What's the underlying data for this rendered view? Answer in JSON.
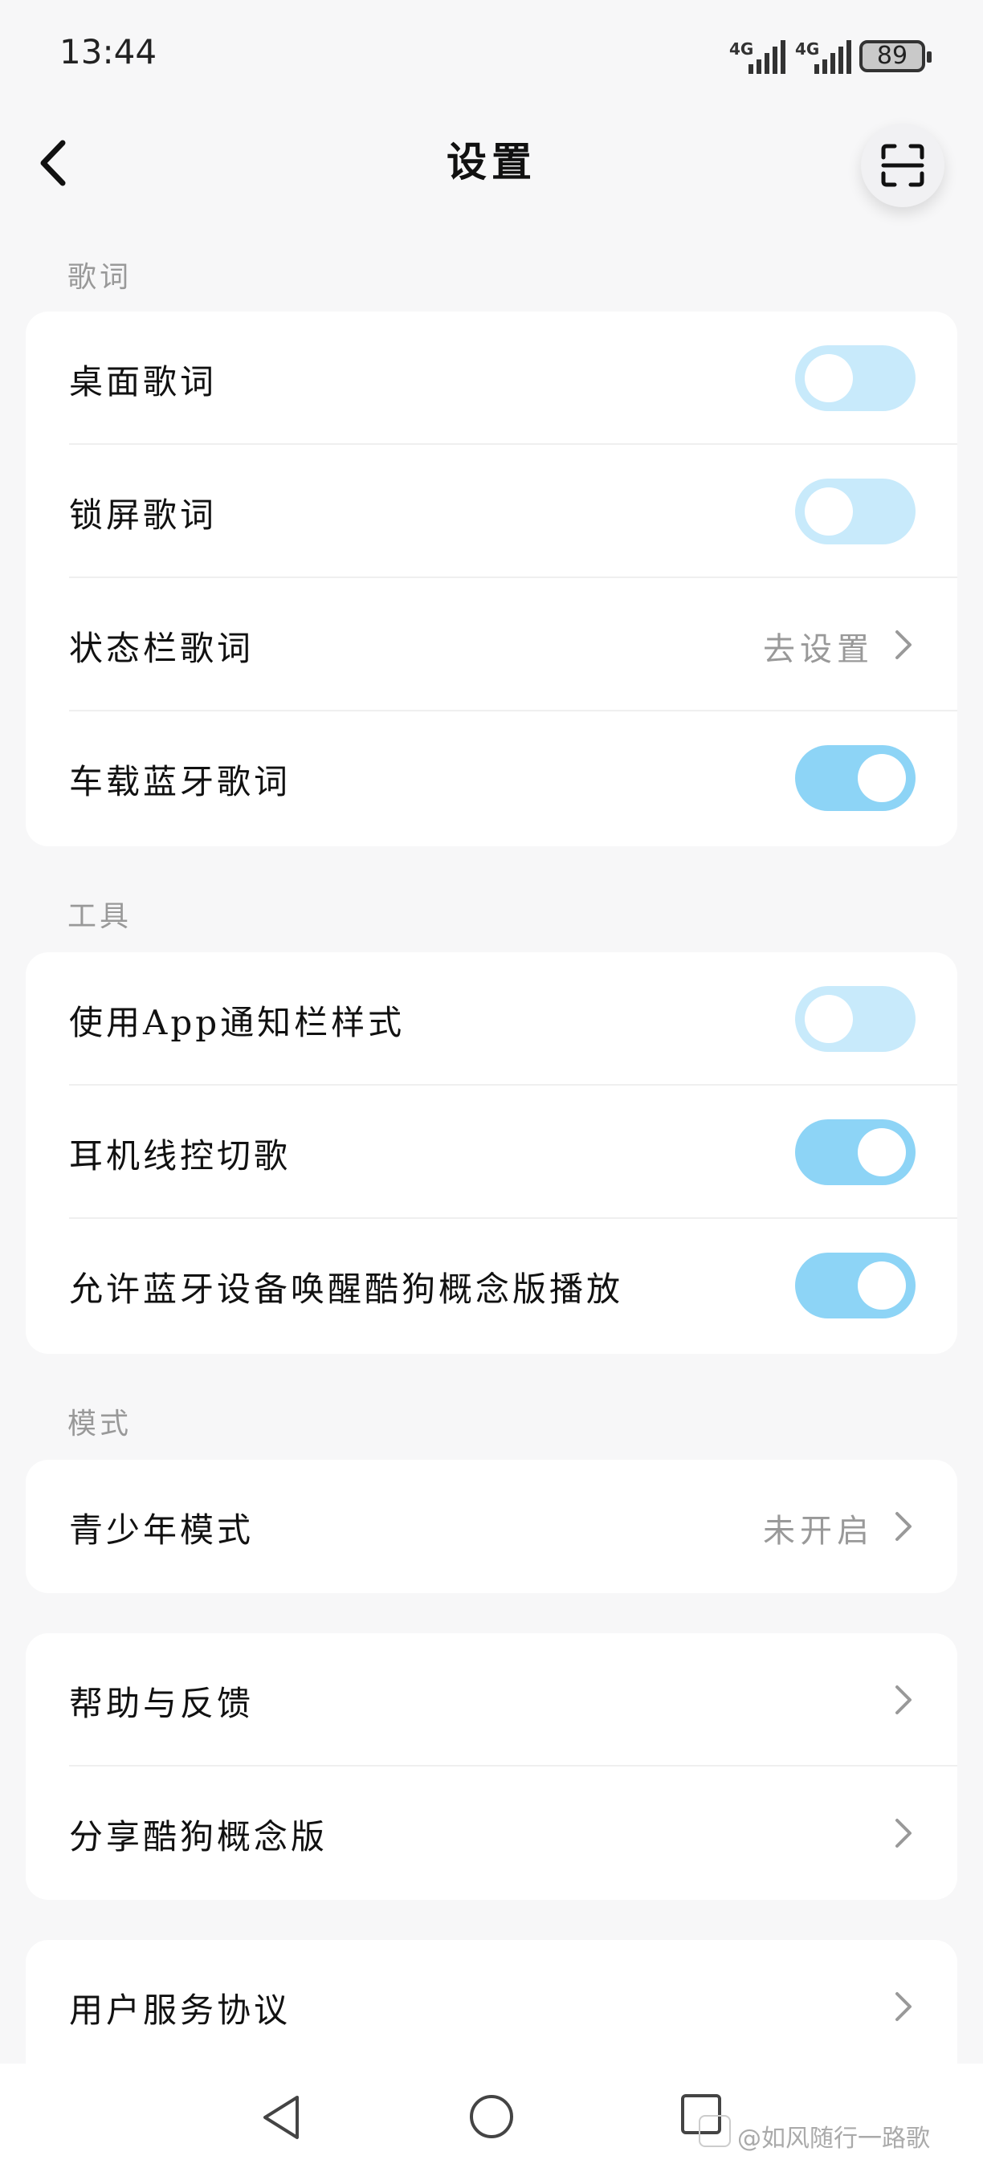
{
  "status_bar": {
    "time": "13:44",
    "network1": "4G",
    "network2": "4G",
    "battery": "89"
  },
  "header": {
    "title": "设置"
  },
  "sections": {
    "lyrics": {
      "label": "歌词",
      "items": [
        {
          "label": "桌面歌词",
          "toggle": "off"
        },
        {
          "label": "锁屏歌词",
          "toggle": "off"
        },
        {
          "label": "状态栏歌词",
          "value": "去设置"
        },
        {
          "label": "车载蓝牙歌词",
          "toggle": "on"
        }
      ]
    },
    "tools": {
      "label": "工具",
      "items": [
        {
          "label": "使用App通知栏样式",
          "toggle": "off"
        },
        {
          "label": "耳机线控切歌",
          "toggle": "on"
        },
        {
          "label": "允许蓝牙设备唤醒酷狗概念版播放",
          "toggle": "on"
        }
      ]
    },
    "mode": {
      "label": "模式",
      "items": [
        {
          "label": "青少年模式",
          "value": "未开启"
        }
      ]
    },
    "help": {
      "items": [
        {
          "label": "帮助与反馈"
        },
        {
          "label": "分享酷狗概念版"
        }
      ]
    },
    "agreement": {
      "items": [
        {
          "label": "用户服务协议"
        }
      ]
    }
  },
  "watermark": "@如风随行一路歌",
  "colors": {
    "toggle_on": "#8dd4f6",
    "toggle_off": "#c8eafb",
    "background": "#f7f7f8"
  }
}
